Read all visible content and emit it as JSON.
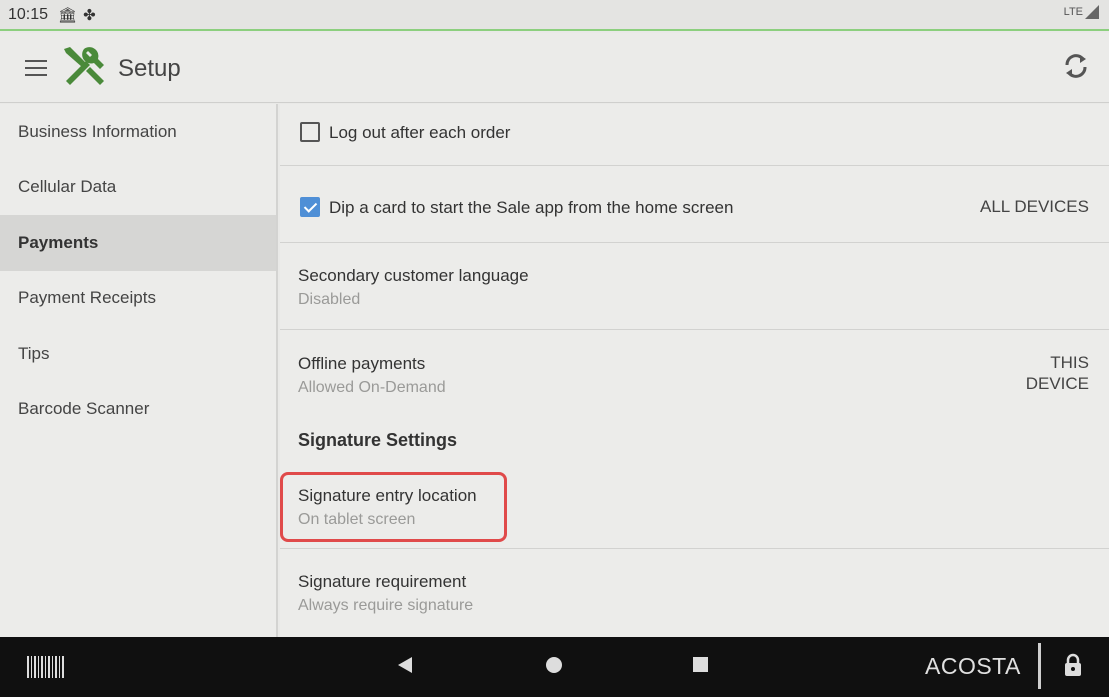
{
  "status_bar": {
    "time": "10:15",
    "icons": [
      "bank-icon",
      "pinwheel-icon"
    ],
    "network": "LTE"
  },
  "app_bar": {
    "title": "Setup",
    "menu_icon": "menu-icon",
    "app_icon": "tools-icon",
    "sync_icon": "sync-icon"
  },
  "sidebar": {
    "items": [
      {
        "label": "Business Information",
        "active": false
      },
      {
        "label": "Cellular Data",
        "active": false
      },
      {
        "label": "Payments",
        "active": true
      },
      {
        "label": "Payment Receipts",
        "active": false
      },
      {
        "label": "Tips",
        "active": false
      },
      {
        "label": "Barcode Scanner",
        "active": false
      }
    ]
  },
  "settings": {
    "logout_after_order": {
      "label": "Log out after each order",
      "checked": false
    },
    "dip_card": {
      "label": "Dip a card to start the Sale app from the home screen",
      "checked": true,
      "scope": "ALL DEVICES"
    },
    "secondary_language": {
      "label": "Secondary customer language",
      "value": "Disabled"
    },
    "offline_payments": {
      "label": "Offline payments",
      "value": "Allowed On-Demand",
      "scope_line1": "THIS",
      "scope_line2": "DEVICE"
    },
    "signature_section_title": "Signature Settings",
    "signature_location": {
      "label": "Signature entry location",
      "value": "On tablet screen"
    },
    "signature_requirement": {
      "label": "Signature requirement",
      "value": "Always require signature"
    }
  },
  "nav_bar": {
    "user": "ACOSTA",
    "icons": [
      "barcode-icon",
      "back-icon",
      "home-icon",
      "recent-apps-icon",
      "lock-icon"
    ]
  },
  "colors": {
    "status_accent": "#8ccf7e",
    "checkbox_checked": "#4f8fd6",
    "highlight_border": "#e04a4a",
    "nav_bar_bg": "#101010"
  }
}
